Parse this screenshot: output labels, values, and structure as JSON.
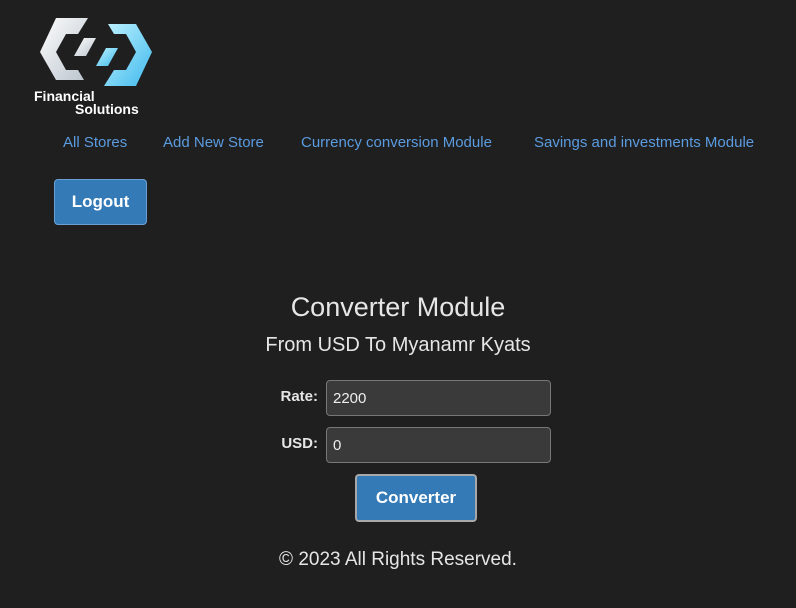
{
  "logo": {
    "line1": "Financial",
    "line2": "Solutions",
    "icon": "interlocking-hexagon-logo-icon"
  },
  "nav": {
    "items": [
      {
        "label": "All Stores"
      },
      {
        "label": "Add New Store"
      },
      {
        "label": "Currency conversion Module"
      },
      {
        "label": "Savings and investments Module"
      }
    ]
  },
  "logout": {
    "label": "Logout"
  },
  "converter": {
    "title": "Converter Module",
    "subtitle": "From USD To Myanamr Kyats",
    "rate_label": "Rate:",
    "rate_value": "2200",
    "usd_label": "USD:",
    "usd_value": "0",
    "button_label": "Converter"
  },
  "footer": {
    "text": "© 2023 All Rights Reserved."
  },
  "colors": {
    "background": "#1f1f1f",
    "link": "#5b9be0",
    "button": "#337ab7",
    "text": "#e6e6e6"
  }
}
